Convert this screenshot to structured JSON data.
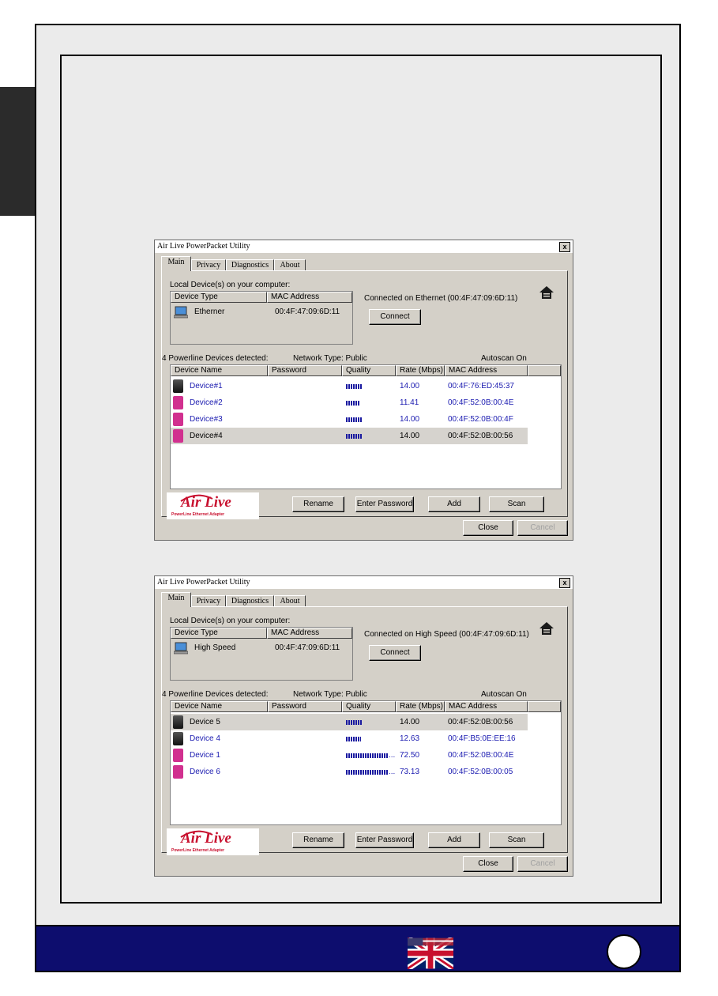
{
  "page": {
    "page_number": ""
  },
  "windows": [
    {
      "title": "Air Live PowerPacket Utility",
      "close_glyph": "x",
      "tabs": [
        "Main",
        "Privacy",
        "Diagnostics",
        "About"
      ],
      "local_label": "Local Device(s) on your computer:",
      "local_columns": [
        "Device Type",
        "MAC Address"
      ],
      "local_device": {
        "type": "Etherner",
        "mac": "00:4F:47:09:6D:11"
      },
      "connected_text": "Connected on  Ethernet  (00:4F:47:09:6D:11)",
      "connect_label": "Connect",
      "detected_label": "4 Powerline Devices detected:",
      "network_type": "Network Type: Public",
      "autoscan": "Autoscan On",
      "columns": [
        "Device Name",
        "Password",
        "Quality",
        "Rate (Mbps)",
        "MAC Address"
      ],
      "devices": [
        {
          "name": "Device#1",
          "icon": "black-adapter-icon",
          "quality": 0.34,
          "quality_suffix": "",
          "rate": "14.00",
          "mac": "00:4F:76:ED:45:37",
          "selected": false
        },
        {
          "name": "Device#2",
          "icon": "pink-adapter-icon",
          "quality": 0.28,
          "quality_suffix": "",
          "rate": "11.41",
          "mac": "00:4F:52:0B:00:4E",
          "selected": false
        },
        {
          "name": "Device#3",
          "icon": "pink-adapter-icon",
          "quality": 0.34,
          "quality_suffix": "",
          "rate": "14.00",
          "mac": "00:4F:52:0B:00:4F",
          "selected": false
        },
        {
          "name": "Device#4",
          "icon": "pink-adapter-icon",
          "quality": 0.34,
          "quality_suffix": "",
          "rate": "14.00",
          "mac": "00:4F:52:0B:00:56",
          "selected": true
        }
      ],
      "logo": {
        "brand": "Air Live",
        "tagline": "PowerLine Ethernet Adapter"
      },
      "buttons": {
        "rename": "Rename",
        "enter_password": "Enter Password",
        "add": "Add",
        "scan": "Scan",
        "close": "Close",
        "cancel": "Cancel"
      }
    },
    {
      "title": "Air Live PowerPacket Utility",
      "close_glyph": "x",
      "tabs": [
        "Main",
        "Privacy",
        "Diagnostics",
        "About"
      ],
      "local_label": "Local Device(s) on your computer:",
      "local_columns": [
        "Device Type",
        "MAC Address"
      ],
      "local_device": {
        "type": "High Speed",
        "mac": "00:4F:47:09:6D:11"
      },
      "connected_text": "Connected on  High Speed  (00:4F:47:09:6D:11)",
      "connect_label": "Connect",
      "detected_label": "4 Powerline Devices detected:",
      "network_type": "Network Type: Public",
      "autoscan": "Autoscan On",
      "columns": [
        "Device Name",
        "Password",
        "Quality",
        "Rate (Mbps)",
        "MAC Address"
      ],
      "devices": [
        {
          "name": "Device 5",
          "icon": "black-adapter-icon",
          "quality": 0.34,
          "quality_suffix": "",
          "rate": "14.00",
          "mac": "00:4F:52:0B:00:56",
          "selected": true
        },
        {
          "name": "Device 4",
          "icon": "black-adapter-icon",
          "quality": 0.31,
          "quality_suffix": "",
          "rate": "12.63",
          "mac": "00:4F:B5:0E:EE:16",
          "selected": false
        },
        {
          "name": "Device 1",
          "icon": "pink-adapter-icon",
          "quality": 0.88,
          "quality_suffix": "...",
          "rate": "72.50",
          "mac": "00:4F:52:0B:00:4E",
          "selected": false
        },
        {
          "name": "Device 6",
          "icon": "pink-adapter-icon",
          "quality": 0.88,
          "quality_suffix": "...",
          "rate": "73.13",
          "mac": "00:4F:52:0B:00:05",
          "selected": false
        }
      ],
      "logo": {
        "brand": "Air Live",
        "tagline": "PowerLine Ethernet Adapter"
      },
      "buttons": {
        "rename": "Rename",
        "enter_password": "Enter Password",
        "add": "Add",
        "scan": "Scan",
        "close": "Close",
        "cancel": "Cancel"
      }
    }
  ]
}
